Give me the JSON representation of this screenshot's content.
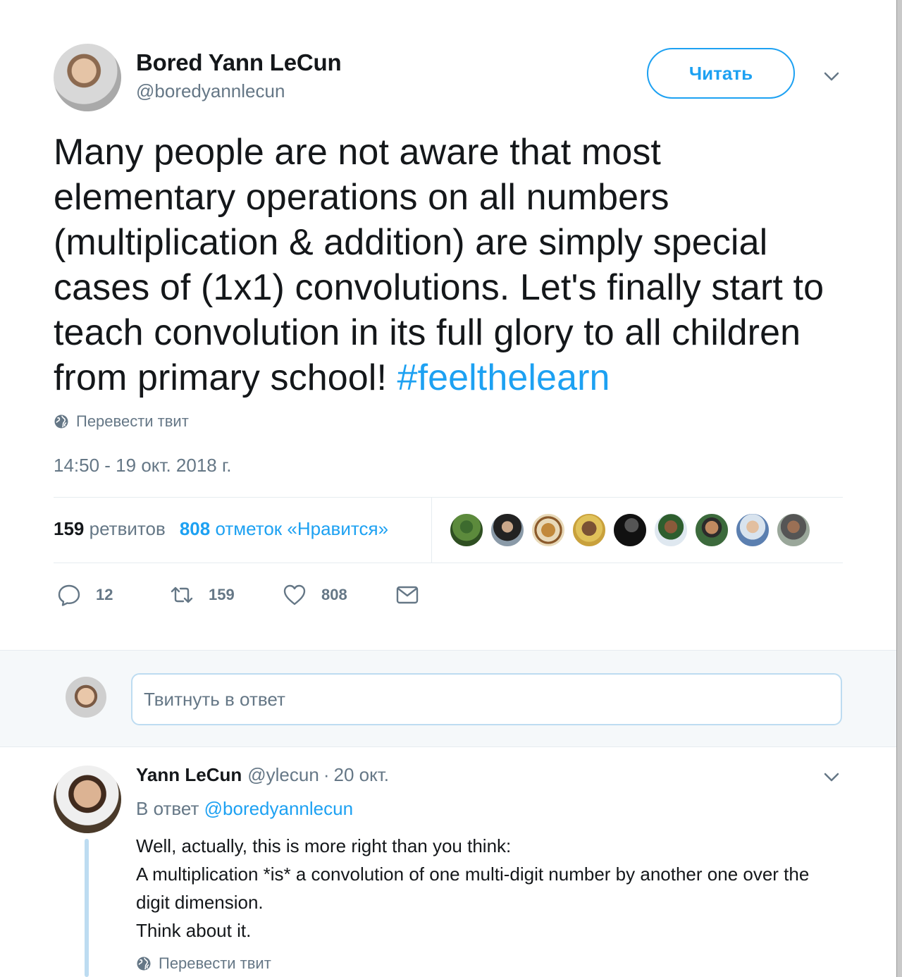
{
  "tweet": {
    "author": {
      "name": "Bored Yann LeCun",
      "handle": "@boredyannlecun"
    },
    "follow_label": "Читать",
    "text_before": "Many people are not aware that most elementary operations on all numbers (multiplication & addition) are simply special cases of (1x1) convolutions. Let's finally start to teach convolution in its full glory to all children from primary school! ",
    "hashtag": "#feelthelearn",
    "translate_label": "Перевести твит",
    "timestamp": "14:50 - 19 окт. 2018 г.",
    "stats": {
      "retweets_count": "159",
      "retweets_label": "ретвитов",
      "likes_count": "808",
      "likes_label": "отметок «Нравится»"
    },
    "actions": {
      "replies": "12",
      "retweets": "159",
      "likes": "808"
    },
    "colors": {
      "accent": "#1da1f2",
      "muted": "#657786",
      "border": "#e6ecf0"
    }
  },
  "reply_box": {
    "placeholder": "Твитнуть в ответ"
  },
  "reply": {
    "name": "Yann LeCun",
    "handle": "@ylecun",
    "dot": "·",
    "date": "20 окт.",
    "in_reply_label": "В ответ",
    "in_reply_handle": "@boredyannlecun",
    "lines": [
      "Well, actually, this is more right than you think:",
      "A multiplication *is* a convolution of one multi-digit number by another one over the digit dimension.",
      "Think about it."
    ],
    "translate_label": "Перевести твит"
  }
}
